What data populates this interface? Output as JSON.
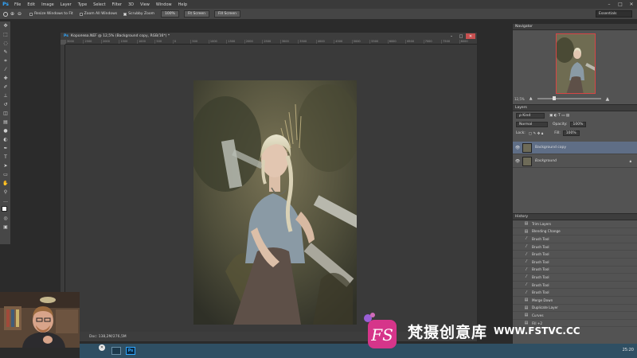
{
  "menubar": {
    "app_logo": "Ps",
    "items": [
      "File",
      "Edit",
      "Image",
      "Layer",
      "Type",
      "Select",
      "Filter",
      "3D",
      "View",
      "Window",
      "Help"
    ],
    "minimize": "–",
    "maximize": "□",
    "close": "✕"
  },
  "options": {
    "resize_windows": "Resize Windows to Fit",
    "zoom_all": "Zoom All Windows",
    "scrubby_zoom": "Scrubby Zoom",
    "btn_100": "100%",
    "btn_fit": "Fit Screen",
    "btn_fill": "Fill Screen",
    "workspace": "Essentials"
  },
  "document": {
    "ps_icon": "Ps",
    "title": "Королева.NEF @ 12,5% (Background copy, RGB/16*) *",
    "ruler_ticks": [
      "3000",
      "2500",
      "2000",
      "1500",
      "1000",
      "500",
      "0",
      "500",
      "1000",
      "1500",
      "2000",
      "2500",
      "3000",
      "3500",
      "4000",
      "4500",
      "5000",
      "5500",
      "6000",
      "6500",
      "7000",
      "7500",
      "8000"
    ],
    "status_zoom": "12,5%",
    "status_doc": "Doc: 138,2M/276,5M"
  },
  "navigator": {
    "tab": "Navigator",
    "zoom": "12,5%",
    "view_fraction": 0.25
  },
  "layers": {
    "tab": "Layers",
    "kind_label": "ρ Kind",
    "blend_mode": "Normal",
    "opacity_label": "Opacity:",
    "opacity_value": "100%",
    "lock_label": "Lock:",
    "fill_label": "Fill:",
    "fill_value": "100%",
    "items": [
      {
        "name": "Background copy",
        "selected": true
      },
      {
        "name": "Background",
        "selected": false
      }
    ]
  },
  "history": {
    "tab": "History",
    "items": [
      "Trim Layers",
      "Blending Change",
      "Brush Tool",
      "Brush Tool",
      "Brush Tool",
      "Brush Tool",
      "Brush Tool",
      "Brush Tool",
      "Brush Tool",
      "Brush Tool",
      "Merge Down",
      "Duplicate Layer",
      "Curves",
      "Fill +2"
    ]
  },
  "taskbar": {
    "close_glyph": "✕",
    "ps_glyph": "Ps",
    "time": "25:20"
  },
  "watermark": {
    "logo_text": "FS",
    "cn_text": "梵摄创意库",
    "url": "WWW.FSTVC.CC"
  },
  "colors": {
    "accent": "#31a8ff",
    "panel_bg": "#535353",
    "selected_layer": "#5f6e86",
    "watermark_pink": "#d6358a"
  }
}
